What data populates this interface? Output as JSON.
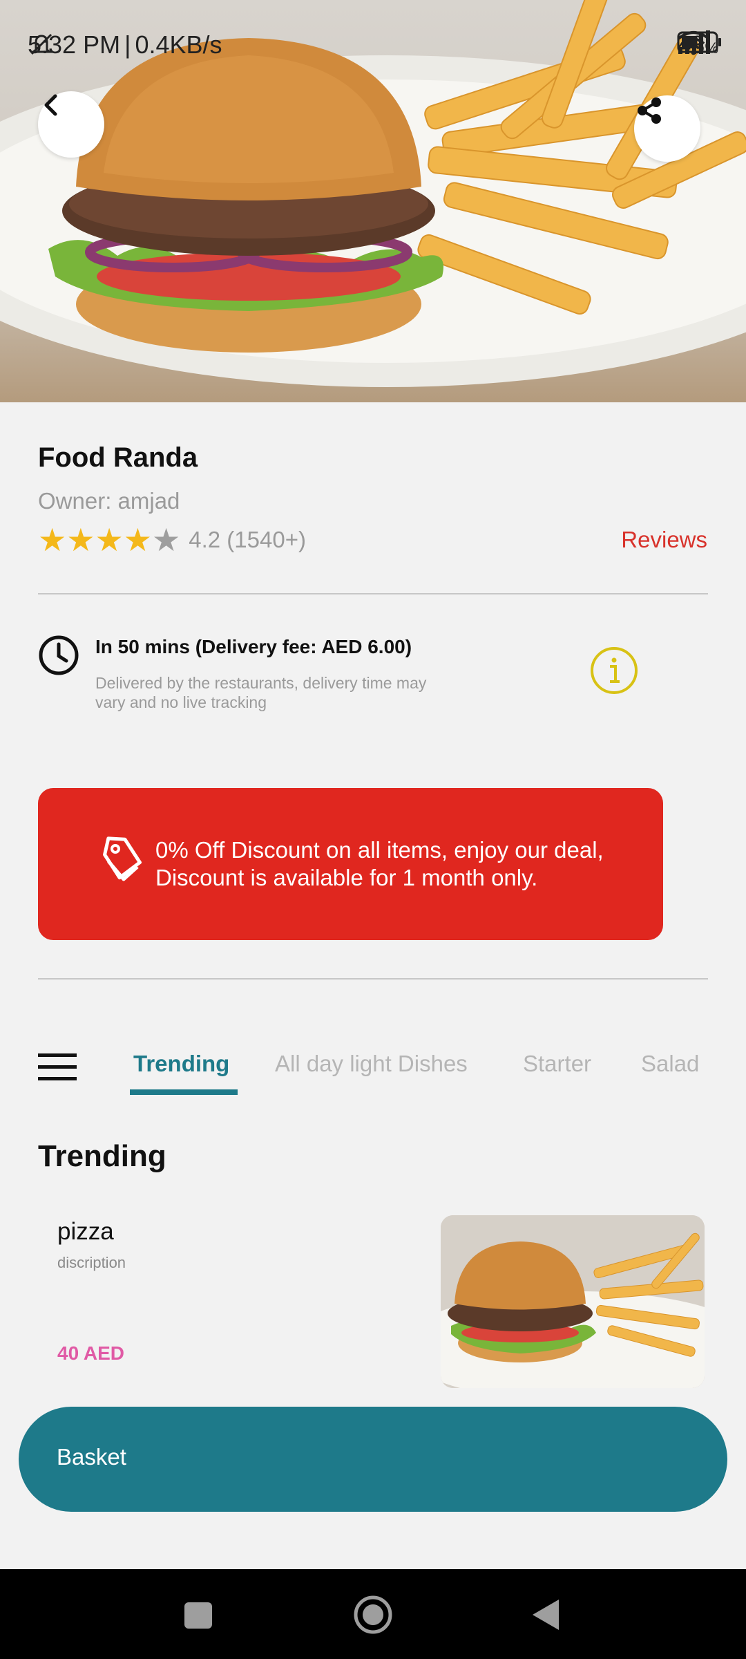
{
  "status_bar": {
    "time": "5:32 PM",
    "separator": " | ",
    "network_speed": "0.4KB/s",
    "battery": "43",
    "battery_unit": "%"
  },
  "header": {
    "back_icon": "chevron-left-icon",
    "share_icon": "share-icon"
  },
  "restaurant": {
    "name": "Food Randa",
    "owner": "Owner: amjad",
    "rating": 4.2,
    "rating_text": "4.2 (1540+)",
    "stars": [
      "on",
      "on",
      "on",
      "on",
      "off"
    ],
    "reviews_link": "Reviews"
  },
  "delivery": {
    "title": "In 50 mins (Delivery fee: AED 6.00)",
    "description": "Delivered by the restaurants, delivery time may\n vary and no live tracking"
  },
  "promo": {
    "text": "0% Off Discount on all items, enjoy our deal, Discount is available for 1 month only."
  },
  "tabs": [
    {
      "label": "Trending",
      "active": true
    },
    {
      "label": "All day light Dishes",
      "active": false
    },
    {
      "label": "Starter",
      "active": false
    },
    {
      "label": "Salad",
      "active": false
    }
  ],
  "section_title": "Trending",
  "items": [
    {
      "name": "pizza",
      "description": "discription",
      "price": "40 AED"
    }
  ],
  "basket": {
    "label": "Basket"
  },
  "colors": {
    "accent": "#1e7a8a",
    "promo_bg": "#e0271f",
    "reviews": "#d8322b",
    "price": "#e05aa5",
    "star": "#f4b81a"
  }
}
